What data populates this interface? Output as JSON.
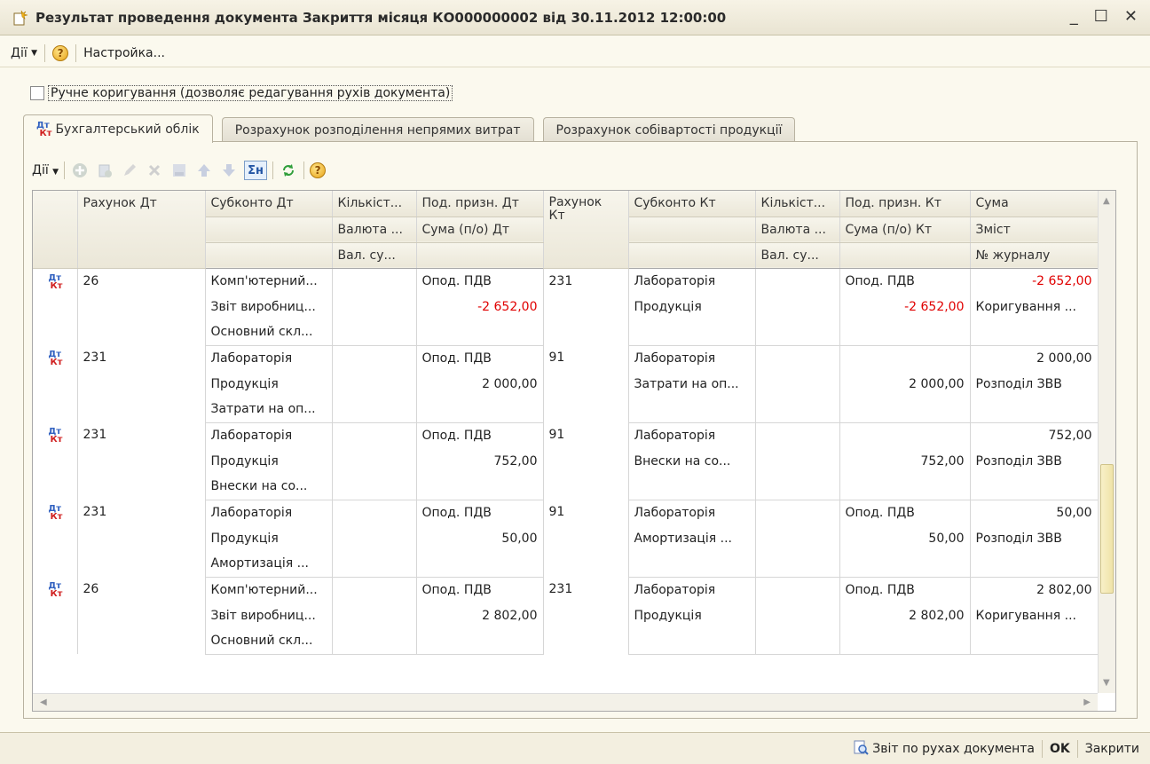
{
  "window": {
    "title": "Результат проведення документа Закриття місяця КО000000002 від 30.11.2012 12:00:00"
  },
  "menu": {
    "actions": "Дії",
    "settings": "Настройка..."
  },
  "checkbox": {
    "label": "Ручне коригування (дозволяє редагування рухів документа)",
    "checked": false
  },
  "tabs": [
    {
      "label": "Бухгалтерський облік",
      "active": true
    },
    {
      "label": "Розрахунок розподілення непрямих витрат",
      "active": false
    },
    {
      "label": "Розрахунок собівартості продукції",
      "active": false
    }
  ],
  "toolbar": {
    "actions": "Дії"
  },
  "columns": {
    "row1": [
      "Рахунок Дт",
      "Субконто Дт",
      "Кількіст...",
      "Под. призн. Дт",
      "Рахунок Кт",
      "Субконто Кт",
      "Кількіст...",
      "Под. призн. Кт",
      "Сума"
    ],
    "row2": [
      "",
      "",
      "Валюта ...",
      "Сума (п/о) Дт",
      "",
      "",
      "Валюта ...",
      "Сума (п/о) Кт",
      "Зміст"
    ],
    "row3": [
      "",
      "",
      "Вал. су...",
      "",
      "",
      "",
      "Вал. су...",
      "",
      "№ журналу"
    ]
  },
  "rows": [
    {
      "dt": "26",
      "kt": "231",
      "subDt": [
        "Комп'ютерний...",
        "Звіт виробниц...",
        "Основний скл..."
      ],
      "subKt": [
        "Лабораторія",
        "Продукція",
        ""
      ],
      "podDt": "Опод. ПДВ",
      "sumPoDt": "-2 652,00",
      "podKt": "Опод. ПДВ",
      "sumPoKt": "-2 652,00",
      "sum": "-2 652,00",
      "content": "Коригування ...",
      "journal": "",
      "negative": true
    },
    {
      "dt": "231",
      "kt": "91",
      "subDt": [
        "Лабораторія",
        "Продукція",
        "Затрати на оп..."
      ],
      "subKt": [
        "Лабораторія",
        "Затрати на оп...",
        ""
      ],
      "podDt": "Опод. ПДВ",
      "sumPoDt": "2 000,00",
      "podKt": "",
      "sumPoKt": "2 000,00",
      "sum": "2 000,00",
      "content": "Розподіл ЗВВ",
      "journal": "",
      "negative": false
    },
    {
      "dt": "231",
      "kt": "91",
      "subDt": [
        "Лабораторія",
        "Продукція",
        "Внески на со..."
      ],
      "subKt": [
        "Лабораторія",
        "Внески на со...",
        ""
      ],
      "podDt": "Опод. ПДВ",
      "sumPoDt": "752,00",
      "podKt": "",
      "sumPoKt": "752,00",
      "sum": "752,00",
      "content": "Розподіл ЗВВ",
      "journal": "",
      "negative": false
    },
    {
      "dt": "231",
      "kt": "91",
      "subDt": [
        "Лабораторія",
        "Продукція",
        "Амортизація ..."
      ],
      "subKt": [
        "Лабораторія",
        "Амортизація ...",
        ""
      ],
      "podDt": "Опод. ПДВ",
      "sumPoDt": "50,00",
      "podKt": "Опод. ПДВ",
      "sumPoKt": "50,00",
      "sum": "50,00",
      "content": "Розподіл ЗВВ",
      "journal": "",
      "negative": false
    },
    {
      "dt": "26",
      "kt": "231",
      "subDt": [
        "Комп'ютерний...",
        "Звіт виробниц...",
        "Основний скл..."
      ],
      "subKt": [
        "Лабораторія",
        "Продукція",
        ""
      ],
      "podDt": "Опод. ПДВ",
      "sumPoDt": "2 802,00",
      "podKt": "Опод. ПДВ",
      "sumPoKt": "2 802,00",
      "sum": "2 802,00",
      "content": "Коригування ...",
      "journal": "",
      "negative": false
    }
  ],
  "status": {
    "report": "Звіт по рухах документа",
    "ok": "OK",
    "close": "Закрити"
  },
  "colors": {
    "negative": "#e00000",
    "background": "#fbf9ee"
  }
}
